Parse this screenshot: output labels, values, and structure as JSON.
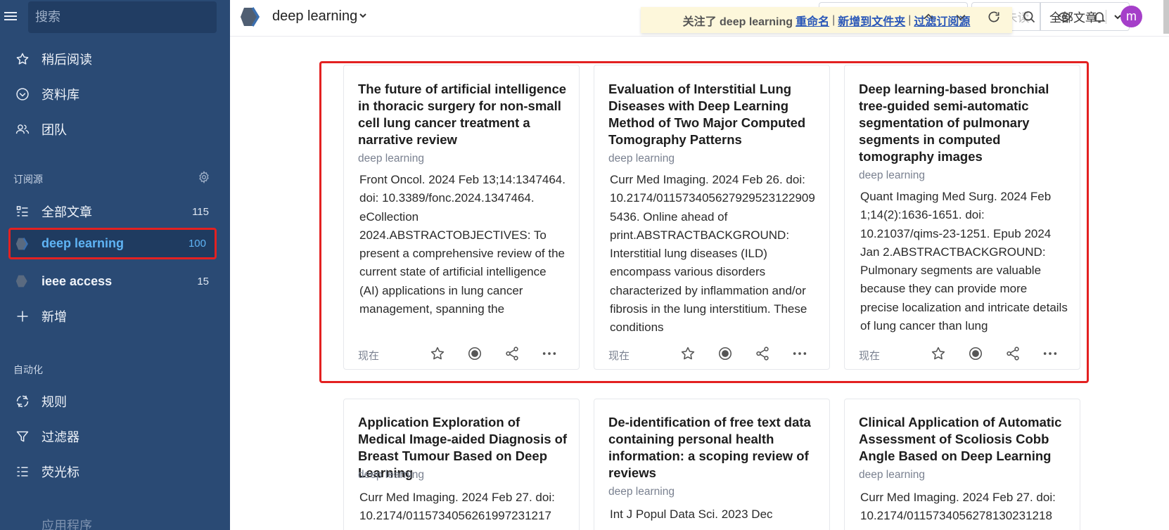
{
  "sidebar": {
    "search_placeholder": "搜索",
    "nav": [
      {
        "label": "稍后阅读"
      },
      {
        "label": "资料库"
      },
      {
        "label": "团队"
      }
    ],
    "feeds_section": "订阅源",
    "feeds": [
      {
        "label": "全部文章",
        "count": "115"
      },
      {
        "label": "deep learning",
        "count": "100"
      },
      {
        "label": "ieee access",
        "count": "15"
      },
      {
        "label": "新增"
      }
    ],
    "automation_section": "自动化",
    "automation": [
      {
        "label": "规则"
      },
      {
        "label": "过滤器"
      },
      {
        "label": "荧光标"
      }
    ],
    "apps_label": "应用程序"
  },
  "topbar": {
    "feed_title": "deep learning",
    "notice": {
      "text": "关注了 deep learning",
      "rename": "重命名",
      "add_folder": "新增到文件夹",
      "filter": "过滤订阅源",
      "sep": "|"
    },
    "unread": "100 未读",
    "filter_select": "全部文章",
    "avatar_letter": "m"
  },
  "cards": [
    {
      "title": "The future of artificial intelligence in thoracic surgery for non-small cell lung cancer treatment a narrative review",
      "feed": "deep learning",
      "body": "Front Oncol. 2024 Feb 13;14:1347464. doi: 10.3389/fonc.2024.1347464. eCollection 2024.ABSTRACTOBJECTIVES: To present a comprehensive review of the current state of artificial intelligence (AI) applications in lung cancer management, spanning the",
      "time": "现在"
    },
    {
      "title": "Evaluation of Interstitial Lung Diseases with Deep Learning Method of Two Major Computed Tomography Patterns",
      "feed": "deep learning",
      "body": "Curr Med Imaging. 2024 Feb 26. doi: 10.2174/0115734056279295231229095436. Online ahead of print.ABSTRACTBACKGROUND: Interstitial lung diseases (ILD) encompass various disorders characterized by inflammation and/or fibrosis in the lung interstitium. These conditions",
      "time": "现在"
    },
    {
      "title": "Deep learning-based bronchial tree-guided semi-automatic segmentation of pulmonary segments in computed tomography images",
      "feed": "deep learning",
      "body": "Quant Imaging Med Surg. 2024 Feb 1;14(2):1636-1651. doi: 10.21037/qims-23-1251. Epub 2024 Jan 2.ABSTRACTBACKGROUND: Pulmonary segments are valuable because they can provide more precise localization and intricate details of lung cancer than lung",
      "time": "现在"
    },
    {
      "title": "Application Exploration of Medical Image-aided Diagnosis of Breast Tumour Based on Deep Learning",
      "feed": "deep learning",
      "body": "Curr Med Imaging. 2024 Feb 27. doi: 10.2174/0115734056261997231217",
      "time": ""
    },
    {
      "title": "De-identification of free text data containing personal health information: a scoping review of reviews",
      "feed": "deep learning",
      "body": "Int J Popul Data Sci. 2023 Dec",
      "time": ""
    },
    {
      "title": "Clinical Application of Automatic Assessment of Scoliosis Cobb Angle Based on Deep Learning",
      "feed": "deep learning",
      "body": "Curr Med Imaging. 2024 Feb 27. doi: 10.2174/0115734056278130231218",
      "time": ""
    }
  ],
  "colors": {
    "sidebar_bg": "#2a4a74",
    "highlight": "#e32121",
    "active_text": "#5fb4f5",
    "avatar": "#a53fc9"
  }
}
